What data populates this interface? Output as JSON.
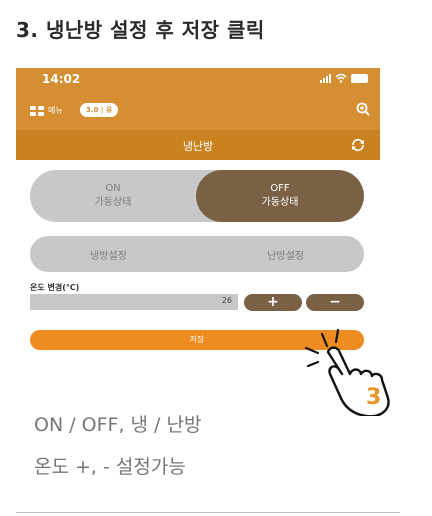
{
  "step_title": "3. 냉난방 설정 후 저장 클릭",
  "phone": {
    "status_time": "14:02",
    "menu_label": "메뉴",
    "version": "3.0 | 유",
    "screen_title": "냉난방",
    "power": {
      "on_top": "ON",
      "on_bottom": "가동상태",
      "off_top": "OFF",
      "off_bottom": "가동상태",
      "selected": "OFF"
    },
    "mode": {
      "cool": "냉방설정",
      "heat": "난방설정"
    },
    "temp_label": "온도 변경(℃)",
    "temp_value": "26",
    "plus": "+",
    "minus": "−",
    "save": "저장",
    "colors": {
      "header": "#d58f32",
      "title_bar": "#c9821f",
      "active": "#7a6045",
      "save": "#ee8c22",
      "inactive": "#c8c8c8"
    }
  },
  "callout_number": "3",
  "descriptions": [
    "ON / OFF, 냉 / 난방",
    "온도 +, - 설정가능"
  ]
}
